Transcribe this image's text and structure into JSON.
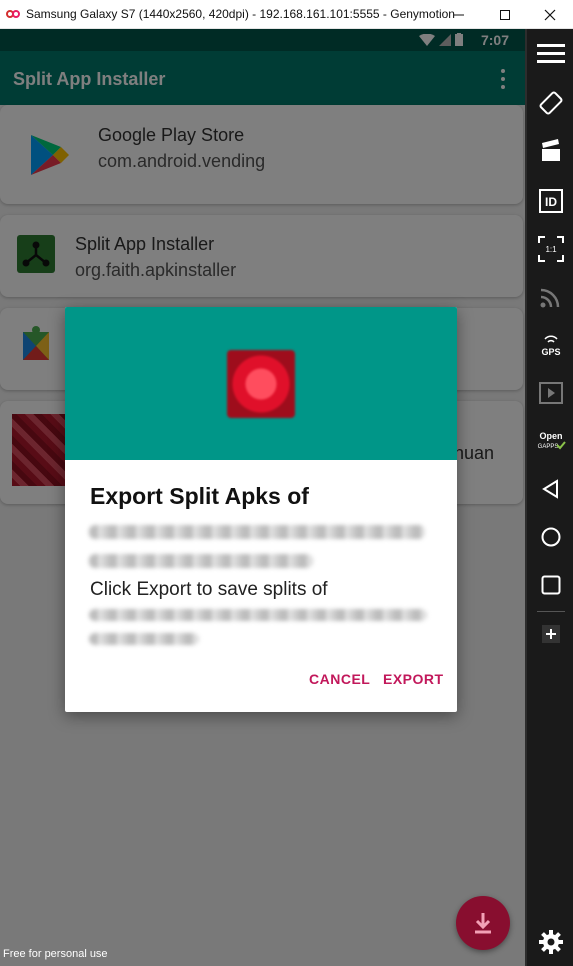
{
  "window": {
    "title": "Samsung Galaxy S7 (1440x2560, 420dpi) - 192.168.161.101:5555 - Genymotion",
    "minimize_icon": "minimize-icon",
    "maximize_icon": "maximize-icon",
    "close_icon": "close-icon"
  },
  "statusbar": {
    "time": "7:07"
  },
  "app": {
    "title": "Split App Installer"
  },
  "apps": [
    {
      "name": "Google Play Store",
      "package": "com.android.vending"
    },
    {
      "name": "Split App Installer",
      "package": "org.faith.apkinstaller"
    },
    {
      "name": "",
      "package": ""
    },
    {
      "name": "",
      "package": "",
      "tail": "huan"
    }
  ],
  "dialog": {
    "title": "Export Split Apks of",
    "message": "Click Export to save splits of",
    "cancel_label": "CANCEL",
    "export_label": "EXPORT"
  },
  "watermark": "Free for personal use",
  "sidebar": {
    "items": [
      "menu-icon",
      "rotate-icon",
      "clapperboard-icon",
      "id-icon",
      "pixel-perfect-icon",
      "cast-icon",
      "gps-icon",
      "media-icon",
      "open-gapps-icon",
      "back-icon",
      "home-icon",
      "recents-icon",
      "add-icon",
      "settings-icon"
    ],
    "pixel_label": "1:1",
    "gps_label": "GPS",
    "opengapps_label": "Open GAPPS"
  },
  "colors": {
    "status_bar": "#00574b",
    "app_bar": "#00796b",
    "dialog_header": "#009688",
    "accent": "#c2185b",
    "fab": "#880e2f"
  }
}
